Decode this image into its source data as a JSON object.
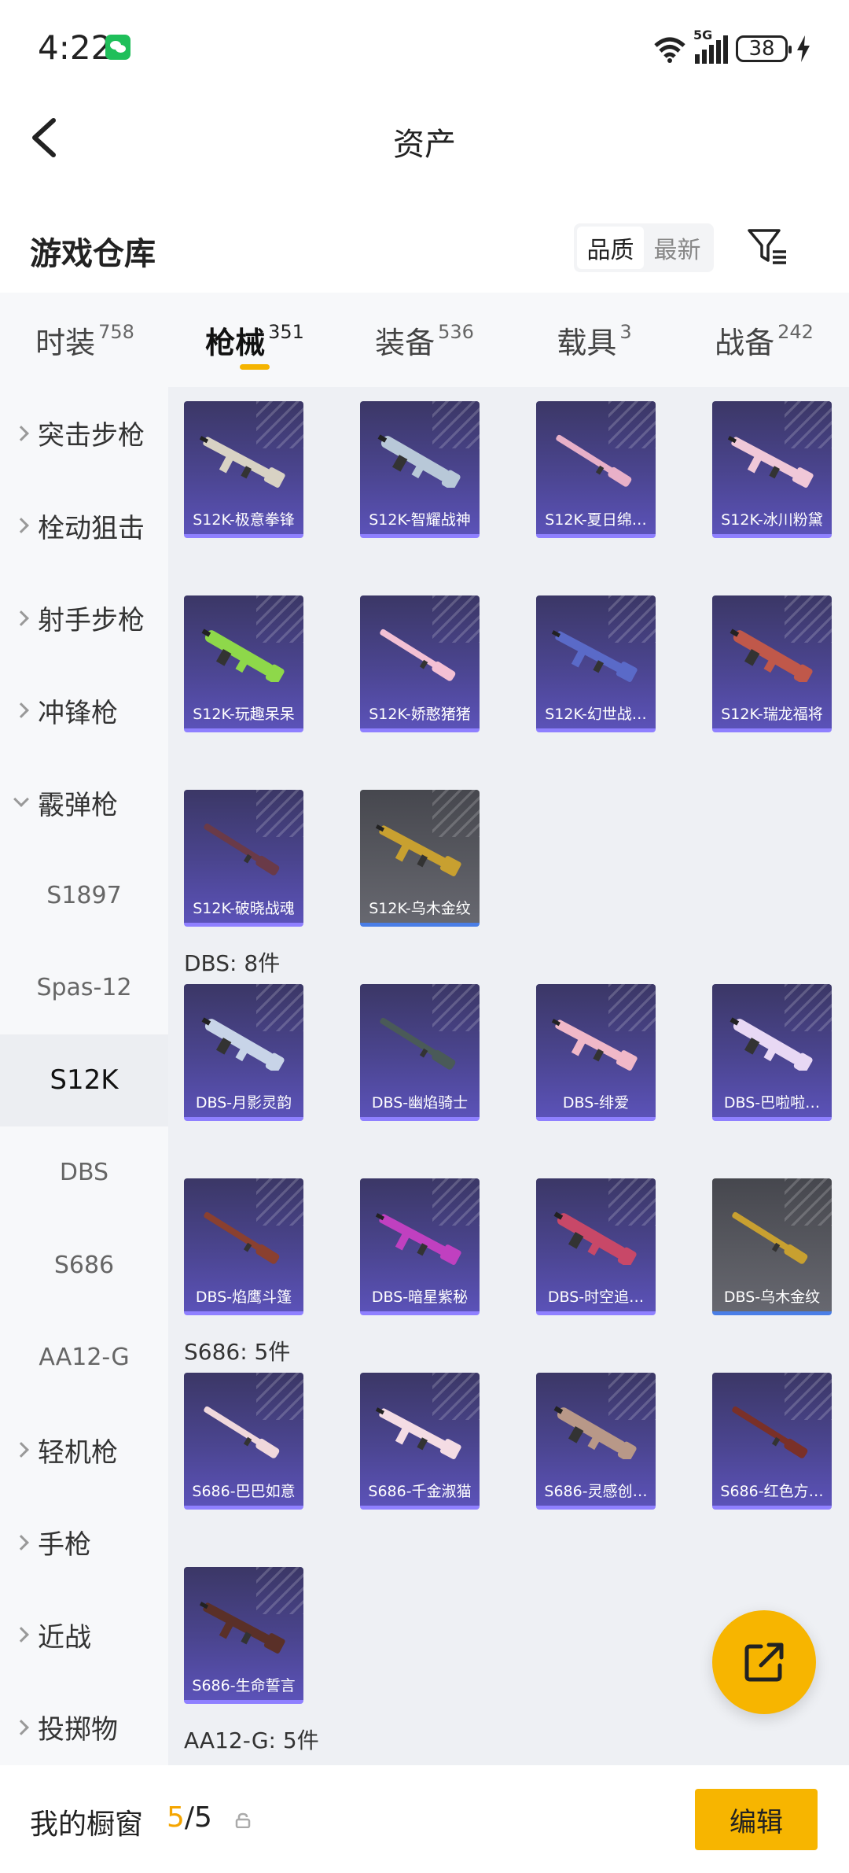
{
  "status": {
    "time": "4:22",
    "network": "5G",
    "battery": "38"
  },
  "header": {
    "title": "资产"
  },
  "warehouse": {
    "title": "游戏仓库",
    "sort_options": [
      "品质",
      "最新"
    ],
    "active_sort": "品质"
  },
  "tabs": [
    {
      "label": "时装",
      "count": "758"
    },
    {
      "label": "枪械",
      "count": "351",
      "active": true
    },
    {
      "label": "装备",
      "count": "536"
    },
    {
      "label": "载具",
      "count": "3"
    },
    {
      "label": "战备",
      "count": "242"
    }
  ],
  "sidebar": [
    {
      "label": "突击步枪",
      "type": "cat"
    },
    {
      "label": "栓动狙击",
      "type": "cat"
    },
    {
      "label": "射手步枪",
      "type": "cat"
    },
    {
      "label": "冲锋枪",
      "type": "cat"
    },
    {
      "label": "霰弹枪",
      "type": "cat",
      "expanded": true
    },
    {
      "label": "S1897",
      "type": "sub"
    },
    {
      "label": "Spas-12",
      "type": "sub"
    },
    {
      "label": "S12K",
      "type": "sub",
      "active": true
    },
    {
      "label": "DBS",
      "type": "sub"
    },
    {
      "label": "S686",
      "type": "sub"
    },
    {
      "label": "AA12-G",
      "type": "sub"
    },
    {
      "label": "轻机枪",
      "type": "cat"
    },
    {
      "label": "手枪",
      "type": "cat"
    },
    {
      "label": "近战",
      "type": "cat"
    },
    {
      "label": "投掷物",
      "type": "cat"
    }
  ],
  "sections": [
    {
      "label": "",
      "items": [
        {
          "name": "S12K-极意拳锋",
          "color": "#d8d2c4"
        },
        {
          "name": "S12K-智耀战神",
          "color": "#b8c8d8"
        },
        {
          "name": "S12K-夏日绵…",
          "color": "#e8b0c8"
        },
        {
          "name": "S12K-冰川粉黛",
          "color": "#f0c8d8"
        },
        {
          "name": "S12K-玩趣呆呆",
          "color": "#8ed84a"
        },
        {
          "name": "S12K-娇憨猪猪",
          "color": "#f4c0d4"
        },
        {
          "name": "S12K-幻世战…",
          "color": "#5a6ac8"
        },
        {
          "name": "S12K-瑞龙福将",
          "color": "#c0584a"
        },
        {
          "name": "S12K-破晓战魂",
          "color": "#6a3a48"
        },
        {
          "name": "S12K-乌木金纹",
          "color": "#c8a030",
          "gold": true
        }
      ]
    },
    {
      "label": "DBS: 8件",
      "items": [
        {
          "name": "DBS-月影灵韵",
          "color": "#c8d4e8"
        },
        {
          "name": "DBS-幽焰骑士",
          "color": "#4a5a58"
        },
        {
          "name": "DBS-绯爱",
          "color": "#f0b8c8"
        },
        {
          "name": "DBS-巴啦啦…",
          "color": "#e8d8f4"
        },
        {
          "name": "DBS-焰鹰斗篷",
          "color": "#8a4030"
        },
        {
          "name": "DBS-暗星紫秘",
          "color": "#c040c0"
        },
        {
          "name": "DBS-时空追…",
          "color": "#c84868"
        },
        {
          "name": "DBS-乌木金纹",
          "color": "#c8a030",
          "gold": true
        }
      ]
    },
    {
      "label": "S686: 5件",
      "items": [
        {
          "name": "S686-巴巴如意",
          "color": "#f0d8dc"
        },
        {
          "name": "S686-千金淑猫",
          "color": "#f4dce4"
        },
        {
          "name": "S686-灵感创…",
          "color": "#b89888"
        },
        {
          "name": "S686-红色方…",
          "color": "#7a3028"
        },
        {
          "name": "S686-生命誓言",
          "color": "#5a3028"
        }
      ]
    },
    {
      "label": "AA12-G: 5件",
      "items": []
    }
  ],
  "bottom": {
    "showcase_label": "我的橱窗",
    "showcase_current": "5",
    "showcase_total": "/5",
    "edit_label": "编辑"
  }
}
